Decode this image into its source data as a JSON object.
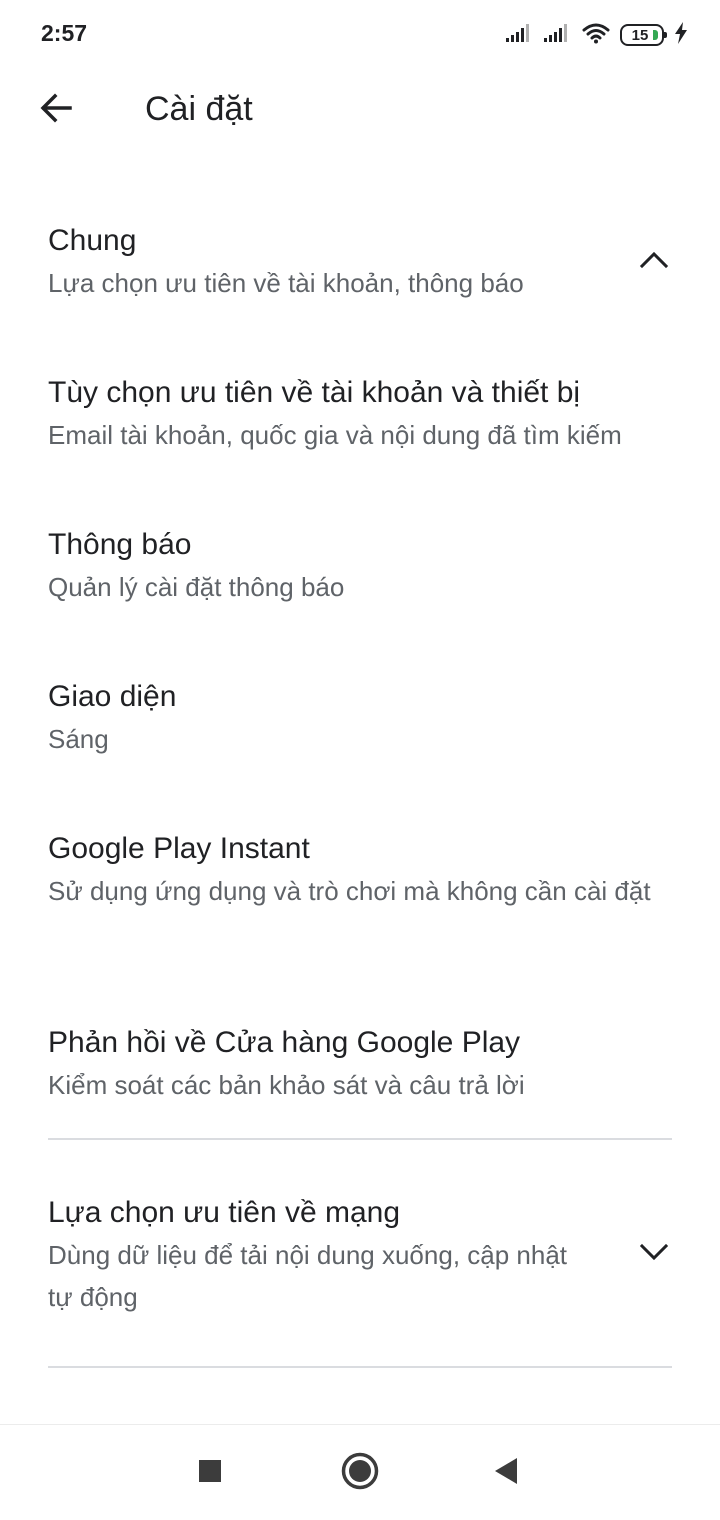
{
  "status_bar": {
    "time": "2:57",
    "battery_level": "15",
    "icons": [
      "signal-icon",
      "signal-icon",
      "wifi-icon",
      "battery-icon",
      "charging-icon"
    ]
  },
  "app_bar": {
    "title": "Cài đặt",
    "back_icon": "arrow-back-icon"
  },
  "sections": {
    "general": {
      "title": "Chung",
      "subtitle": "Lựa chọn ưu tiên về tài khoản, thông báo",
      "expanded": true
    },
    "items": [
      {
        "title": "Tùy chọn ưu tiên về tài khoản và thiết bị",
        "subtitle": "Email tài khoản, quốc gia và nội dung đã tìm kiếm"
      },
      {
        "title": "Thông báo",
        "subtitle": "Quản lý cài đặt thông báo"
      },
      {
        "title": "Giao diện",
        "subtitle": "Sáng"
      },
      {
        "title": "Google Play Instant",
        "subtitle": "Sử dụng ứng dụng và trò chơi mà không cần cài đặt"
      },
      {
        "title": "Phản hồi về Cửa hàng Google Play",
        "subtitle": "Kiểm soát các bản khảo sát và câu trả lời"
      }
    ],
    "network": {
      "title": "Lựa chọn ưu tiên về mạng",
      "subtitle": "Dùng dữ liệu để tải nội dung xuống, cập nhật tự động",
      "expanded": false
    }
  },
  "nav_bar": {
    "recents_icon": "square-icon",
    "home_icon": "circle-icon",
    "back_icon": "triangle-back-icon"
  },
  "colors": {
    "text_primary": "#202124",
    "text_secondary": "#5f6368",
    "divider": "#dadce0",
    "battery_accent": "#34a853"
  }
}
